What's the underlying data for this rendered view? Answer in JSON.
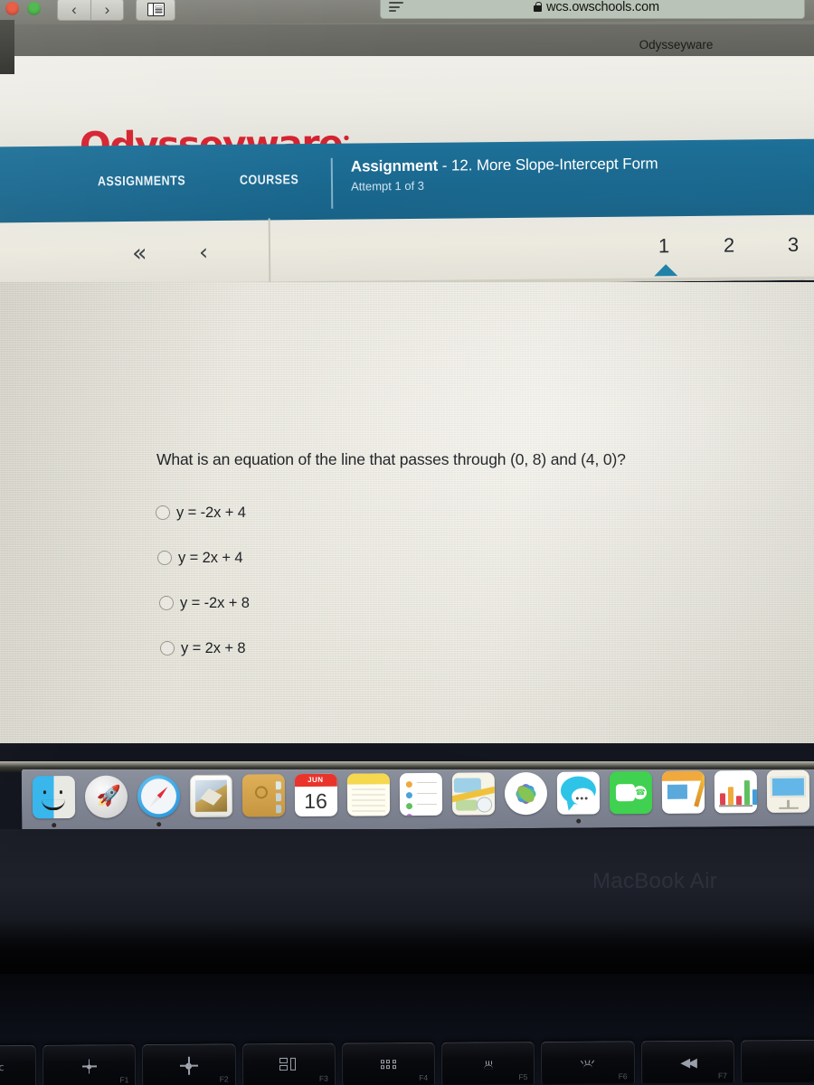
{
  "browser": {
    "url": "wcs.owschools.com",
    "lock_icon": "lock-icon",
    "reader_icon": "reader-view-icon",
    "sidebar_icon": "sidebar-toggle-icon",
    "back_glyph": "‹",
    "forward_glyph": "›",
    "tab_title": "Odysseyware"
  },
  "site": {
    "logo_text": "Odysseyware",
    "logo_mark": "•",
    "brand_color": "#d5212f",
    "nav_color": "#1a688f"
  },
  "nav": {
    "assignments": "ASSIGNMENTS",
    "courses": "COURSES",
    "assignment_label": "Assignment",
    "assignment_name": "- 12. More Slope-Intercept Form",
    "attempt": "Attempt 1 of 3"
  },
  "pager": {
    "first_glyph": "«",
    "prev_glyph": "‹",
    "pages": [
      "1",
      "2",
      "3"
    ],
    "current_page": "1",
    "marker_color": "#1d7fa6"
  },
  "question": {
    "prompt": "What is an equation of the line that passes through (0, 8) and (4, 0)?",
    "choices": [
      {
        "id": "a",
        "text": "y = -2x + 4",
        "selected": false
      },
      {
        "id": "b",
        "text": "y = 2x + 4",
        "selected": false
      },
      {
        "id": "c",
        "text": "y = -2x + 8",
        "selected": false
      },
      {
        "id": "d",
        "text": "y = 2x + 8",
        "selected": false
      }
    ]
  },
  "dock": {
    "items": [
      {
        "name": "finder",
        "label": "Finder",
        "running": true
      },
      {
        "name": "launchpad",
        "label": "Launchpad",
        "running": false
      },
      {
        "name": "safari",
        "label": "Safari",
        "running": true
      },
      {
        "name": "mail",
        "label": "Mail",
        "running": false
      },
      {
        "name": "contacts",
        "label": "Contacts",
        "running": false
      },
      {
        "name": "calendar",
        "label": "Calendar",
        "running": false,
        "month": "JUN",
        "day": "16"
      },
      {
        "name": "notes",
        "label": "Notes",
        "running": false
      },
      {
        "name": "reminders",
        "label": "Reminders",
        "running": false
      },
      {
        "name": "maps",
        "label": "Maps",
        "running": false
      },
      {
        "name": "photos",
        "label": "Photos",
        "running": false
      },
      {
        "name": "messages",
        "label": "Messages",
        "running": true
      },
      {
        "name": "facetime",
        "label": "FaceTime",
        "running": false
      },
      {
        "name": "pages",
        "label": "Pages",
        "running": false
      },
      {
        "name": "numbers",
        "label": "Numbers",
        "running": false
      },
      {
        "name": "keynote",
        "label": "Keynote",
        "running": false
      }
    ]
  },
  "laptop": {
    "model": "MacBook Air",
    "keys": [
      {
        "name": "escape",
        "label": "",
        "glyph": "esc"
      },
      {
        "name": "brightness-down",
        "label": "F1",
        "glyph": "sun-small-icon"
      },
      {
        "name": "brightness-up",
        "label": "F2",
        "glyph": "sun-large-icon"
      },
      {
        "name": "mission-control",
        "label": "F3",
        "glyph": "mission-control-icon"
      },
      {
        "name": "launchpad",
        "label": "F4",
        "glyph": "launchpad-grid-icon"
      },
      {
        "name": "keyboard-light-down",
        "label": "F5",
        "glyph": "keyboard-dim-icon"
      },
      {
        "name": "keyboard-light-up",
        "label": "F6",
        "glyph": "keyboard-bright-icon"
      },
      {
        "name": "rewind",
        "label": "F7",
        "glyph": "rewind-icon"
      }
    ]
  }
}
